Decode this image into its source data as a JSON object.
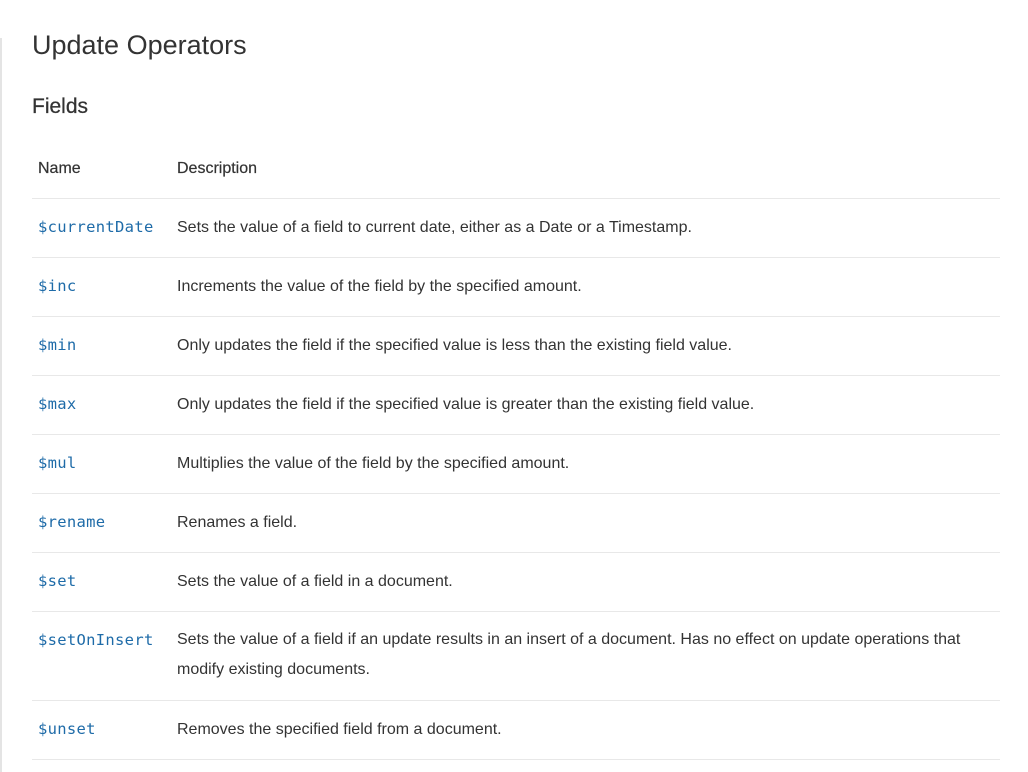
{
  "page": {
    "title": "Update Operators",
    "section_title": "Fields"
  },
  "table": {
    "headers": {
      "name": "Name",
      "description": "Description"
    },
    "rows": [
      {
        "name": "$currentDate",
        "description": "Sets the value of a field to current date, either as a Date or a Timestamp."
      },
      {
        "name": "$inc",
        "description": "Increments the value of the field by the specified amount."
      },
      {
        "name": "$min",
        "description": "Only updates the field if the specified value is less than the existing field value."
      },
      {
        "name": "$max",
        "description": "Only updates the field if the specified value is greater than the existing field value."
      },
      {
        "name": "$mul",
        "description": "Multiplies the value of the field by the specified amount."
      },
      {
        "name": "$rename",
        "description": "Renames a field."
      },
      {
        "name": "$set",
        "description": "Sets the value of a field in a document."
      },
      {
        "name": "$setOnInsert",
        "description": "Sets the value of a field if an update results in an insert of a document. Has no effect on update operations that modify existing documents."
      },
      {
        "name": "$unset",
        "description": "Removes the specified field from a document."
      }
    ]
  },
  "colors": {
    "link": "#1e6ba8",
    "text": "#333333",
    "row_border": "#e8e8e8"
  }
}
